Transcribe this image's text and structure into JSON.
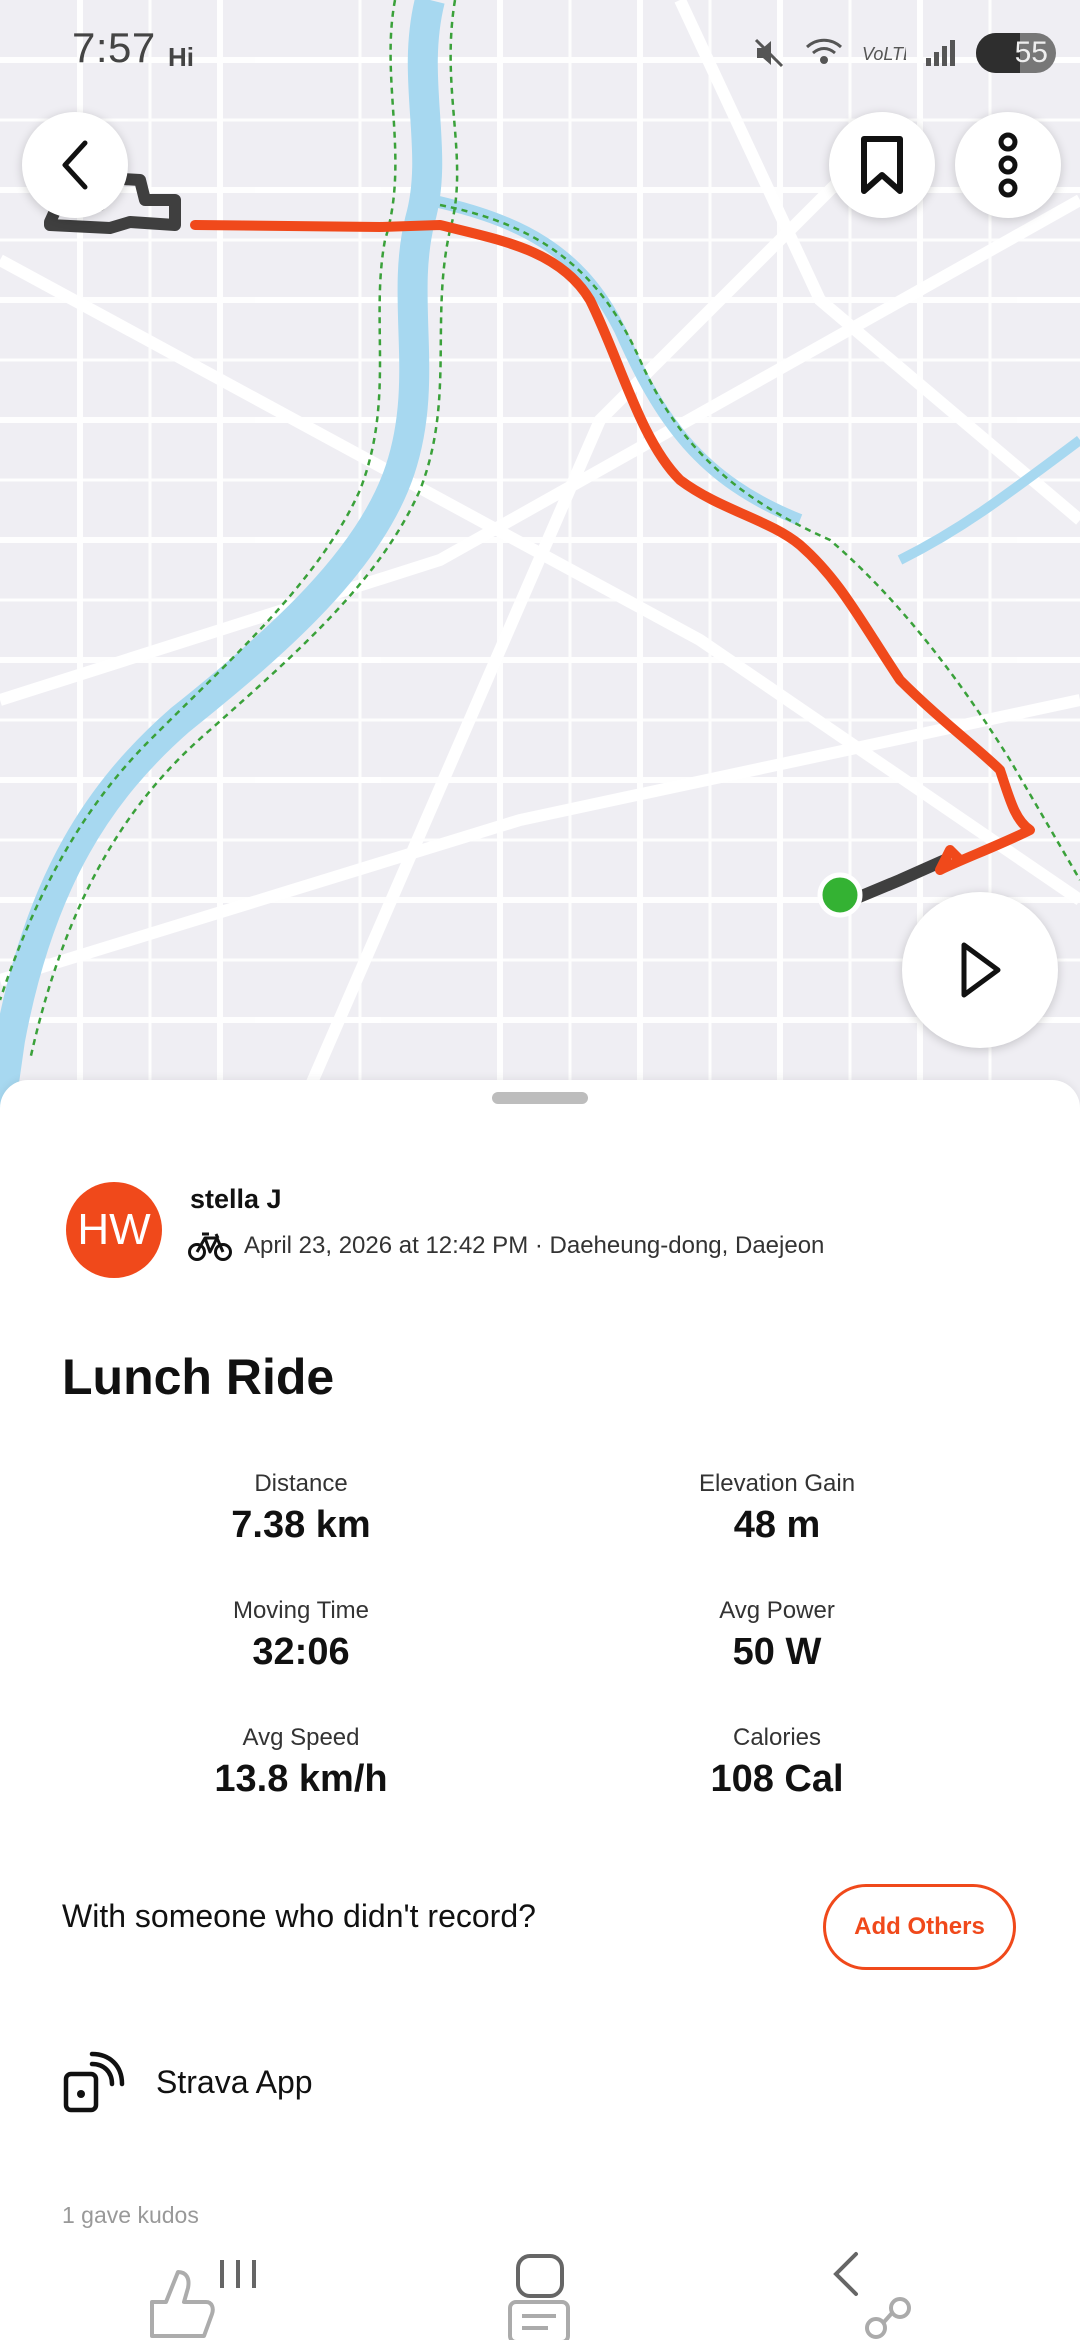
{
  "status": {
    "time": "7:57",
    "hi": "Hi",
    "battery": "55",
    "battery_level": 0.55
  },
  "map": {
    "route_color": "#f0491b",
    "start_color": "#34b233",
    "water_color": "#a7d8f0",
    "trail_color": "#3aa13a"
  },
  "header": {
    "back_icon": "chevron-left-icon",
    "save_icon": "bookmark-icon",
    "more_icon": "more-vertical-icon",
    "play_icon": "play-icon"
  },
  "activity": {
    "athlete_initials": "HW",
    "athlete_name": "stella J",
    "sport_icon": "bicycle-icon",
    "meta": "April 23, 2026 at 12:42 PM · Daeheung-dong, Daejeon",
    "title": "Lunch Ride"
  },
  "stats": [
    {
      "label": "Distance",
      "value": "7.38 km"
    },
    {
      "label": "Elevation Gain",
      "value": "48 m"
    },
    {
      "label": "Moving Time",
      "value": "32:06"
    },
    {
      "label": "Avg Power",
      "value": "50 W"
    },
    {
      "label": "Avg Speed",
      "value": "13.8 km/h"
    },
    {
      "label": "Calories",
      "value": "108 Cal"
    }
  ],
  "others": {
    "question": "With someone who didn't record?",
    "button": "Add Others"
  },
  "device": {
    "label": "Strava App"
  },
  "kudos": {
    "text": "1 gave kudos"
  },
  "colors": {
    "accent": "#f0491b"
  }
}
